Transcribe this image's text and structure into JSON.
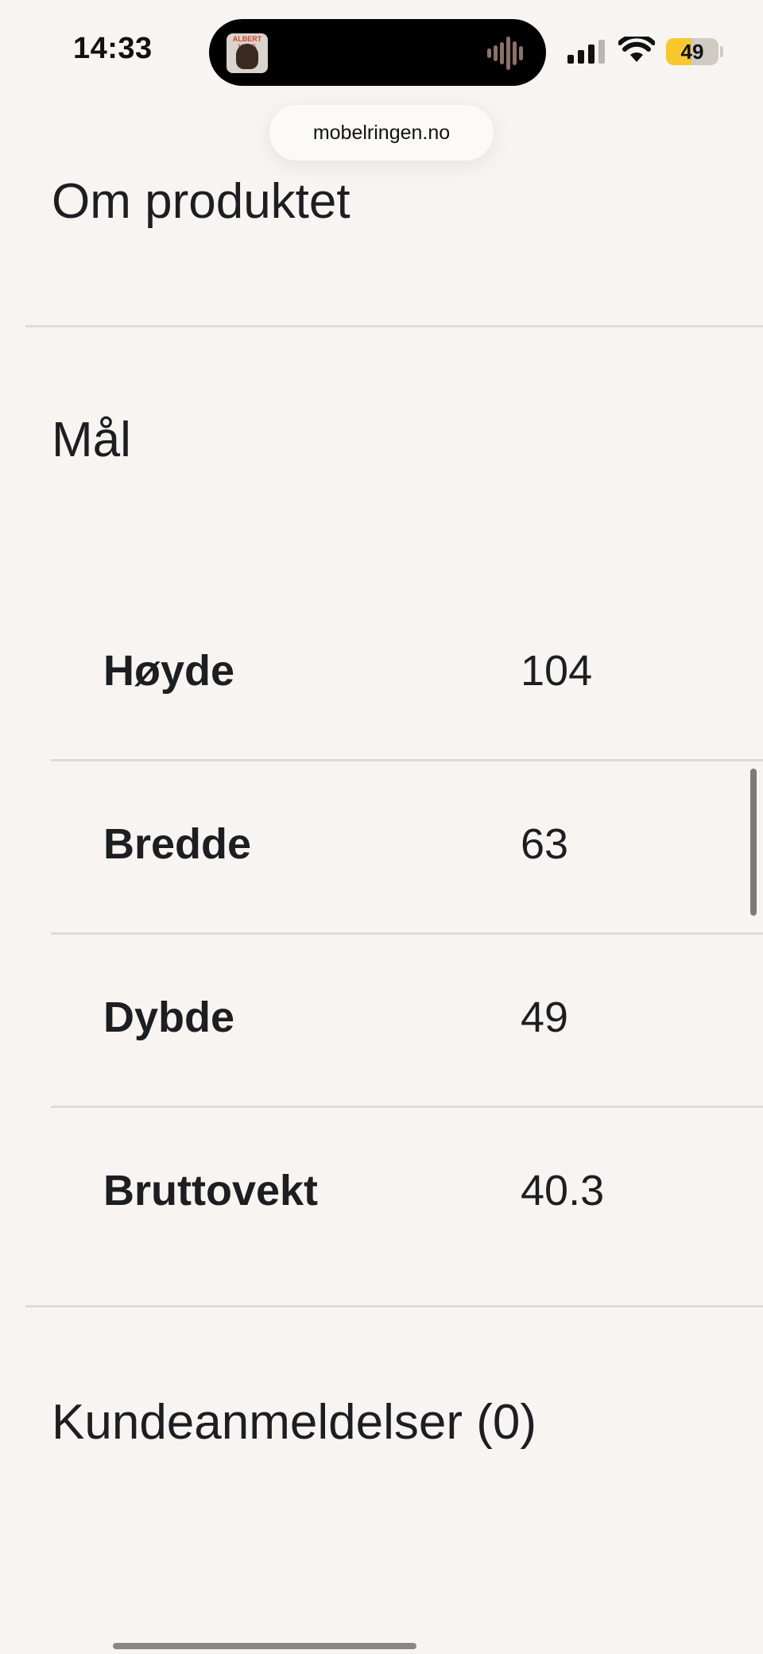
{
  "status_bar": {
    "time": "14:33",
    "battery_level": "49",
    "battery_color": "#f7c92c",
    "now_playing_art_text": "ALBERT KING",
    "icons": [
      "signal-bars-icon",
      "wifi-icon",
      "battery-icon",
      "audio-waveform-icon"
    ]
  },
  "browser": {
    "url": "mobelringen.no"
  },
  "sections": {
    "about": "Om produktet",
    "dimensions": "Mål",
    "reviews": "Kundeanmeldelser (0)"
  },
  "specs": [
    {
      "label": "Høyde",
      "value": "104"
    },
    {
      "label": "Bredde",
      "value": "63"
    },
    {
      "label": "Dybde",
      "value": "49"
    },
    {
      "label": "Bruttovekt",
      "value": "40.3"
    }
  ]
}
